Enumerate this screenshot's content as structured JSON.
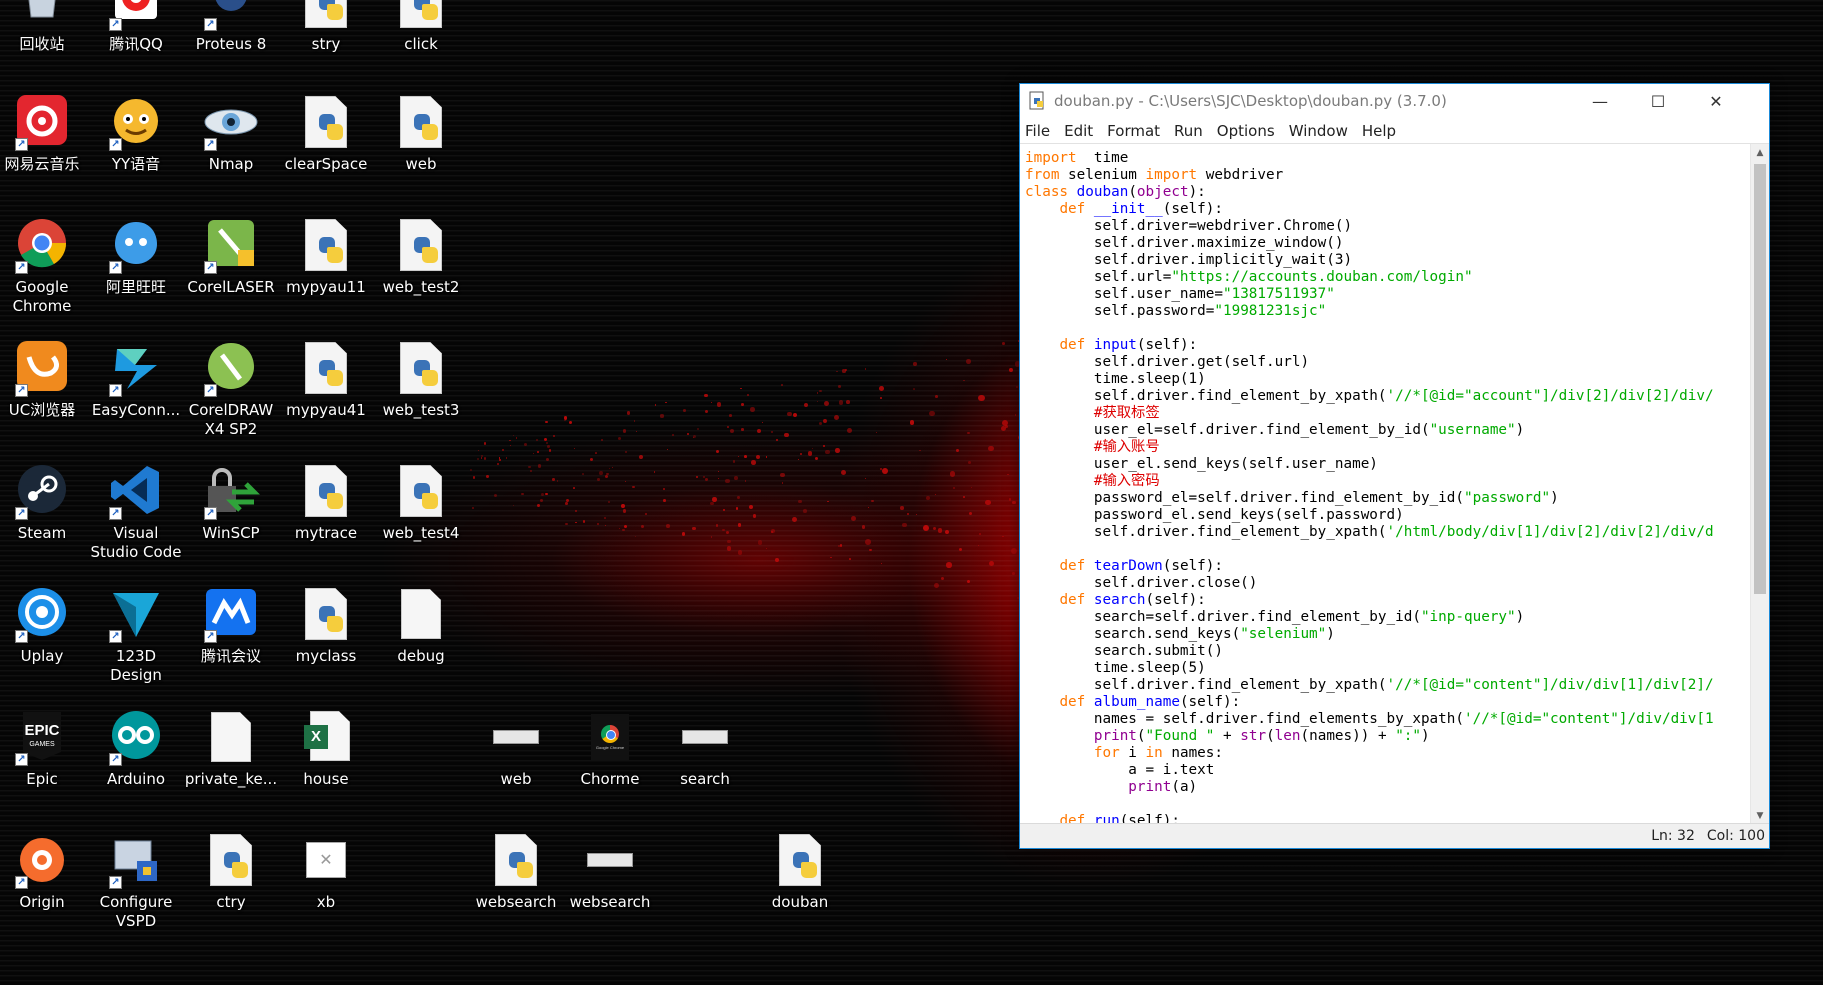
{
  "window": {
    "title": "douban.py - C:\\Users\\SJC\\Desktop\\douban.py (3.7.0)",
    "minimize": "—",
    "maximize": "☐",
    "close": "✕"
  },
  "menu": [
    "File",
    "Edit",
    "Format",
    "Run",
    "Options",
    "Window",
    "Help"
  ],
  "status": {
    "line": "Ln: 32",
    "col": "Col: 100"
  },
  "desktop_icons": [
    {
      "label": "回收站",
      "icon": "recycle-bin-icon"
    },
    {
      "label": "腾讯QQ",
      "icon": "qq-icon"
    },
    {
      "label": "Proteus 8",
      "icon": "proteus-icon"
    },
    {
      "label": "stry",
      "icon": "python-file-icon"
    },
    {
      "label": "click",
      "icon": "python-file-icon"
    },
    {
      "label": "网易云音乐",
      "icon": "netease-music-icon"
    },
    {
      "label": "YY语音",
      "icon": "yy-voice-icon"
    },
    {
      "label": "Nmap",
      "icon": "nmap-icon"
    },
    {
      "label": "clearSpace",
      "icon": "python-file-icon"
    },
    {
      "label": "web",
      "icon": "python-file-icon"
    },
    {
      "label": "Google Chrome",
      "icon": "chrome-icon"
    },
    {
      "label": "阿里旺旺",
      "icon": "aliwangwang-icon"
    },
    {
      "label": "CorelLASER",
      "icon": "corel-laser-icon"
    },
    {
      "label": "mypyau11",
      "icon": "python-file-icon"
    },
    {
      "label": "web_test2",
      "icon": "python-file-icon"
    },
    {
      "label": "UC浏览器",
      "icon": "uc-browser-icon"
    },
    {
      "label": "EasyConn...",
      "icon": "easyconnect-icon"
    },
    {
      "label": "CorelDRAW X4 SP2",
      "icon": "coreldraw-icon"
    },
    {
      "label": "mypyau41",
      "icon": "python-file-icon"
    },
    {
      "label": "web_test3",
      "icon": "python-file-icon"
    },
    {
      "label": "Steam",
      "icon": "steam-icon"
    },
    {
      "label": "Visual Studio Code",
      "icon": "vscode-icon"
    },
    {
      "label": "WinSCP",
      "icon": "winscp-icon"
    },
    {
      "label": "mytrace",
      "icon": "python-file-icon"
    },
    {
      "label": "web_test4",
      "icon": "python-file-icon"
    },
    {
      "label": "Uplay",
      "icon": "uplay-icon"
    },
    {
      "label": "123D Design",
      "icon": "123d-design-icon"
    },
    {
      "label": "腾讯会议",
      "icon": "tencent-meeting-icon"
    },
    {
      "label": "myclass",
      "icon": "python-file-icon"
    },
    {
      "label": "debug",
      "icon": "blank-file-icon"
    },
    {
      "label": "Epic",
      "icon": "epic-games-icon"
    },
    {
      "label": "Arduino",
      "icon": "arduino-icon"
    },
    {
      "label": "private_ke...",
      "icon": "blank-file-icon"
    },
    {
      "label": "house",
      "icon": "excel-file-icon"
    },
    {
      "label": "web",
      "icon": "image-thumbnail-icon"
    },
    {
      "label": "Chorme",
      "icon": "chrome-thumbnail-icon"
    },
    {
      "label": "search",
      "icon": "image-thumbnail-icon"
    },
    {
      "label": "Origin",
      "icon": "origin-icon"
    },
    {
      "label": "Configure VSPD",
      "icon": "vspd-icon"
    },
    {
      "label": "ctry",
      "icon": "python-file-icon"
    },
    {
      "label": "xb",
      "icon": "broken-image-icon"
    },
    {
      "label": "websearch",
      "icon": "python-file-icon"
    },
    {
      "label": "websearch",
      "icon": "image-thumbnail-icon"
    },
    {
      "label": "douban",
      "icon": "python-file-icon"
    }
  ],
  "thumbnail_caption": "Google Chrome",
  "code_lines": [
    [
      [
        "kw",
        "import"
      ],
      [
        "",
        "  time"
      ]
    ],
    [
      [
        "kw",
        "from"
      ],
      [
        "",
        " selenium "
      ],
      [
        "kw",
        "import"
      ],
      [
        "",
        " webdriver"
      ]
    ],
    [
      [
        "kw",
        "class"
      ],
      [
        "",
        " "
      ],
      [
        "fn",
        "douban"
      ],
      [
        "",
        "("
      ],
      [
        "bi",
        "object"
      ],
      [
        "",
        "):"
      ]
    ],
    [
      [
        "",
        "    "
      ],
      [
        "kw",
        "def"
      ],
      [
        "",
        " "
      ],
      [
        "fn",
        "__init__"
      ],
      [
        "",
        "(self):"
      ]
    ],
    [
      [
        "",
        "        self.driver=webdriver.Chrome()"
      ]
    ],
    [
      [
        "",
        "        self.driver.maximize_window()"
      ]
    ],
    [
      [
        "",
        "        self.driver.implicitly_wait(3)"
      ]
    ],
    [
      [
        "",
        "        self.url="
      ],
      [
        "st",
        "\"https://accounts.douban.com/login\""
      ]
    ],
    [
      [
        "",
        "        self.user_name="
      ],
      [
        "st",
        "\"13817511937\""
      ]
    ],
    [
      [
        "",
        "        self.password="
      ],
      [
        "st",
        "\"19981231sjc\""
      ]
    ],
    [
      [
        "",
        ""
      ]
    ],
    [
      [
        "",
        "    "
      ],
      [
        "kw",
        "def"
      ],
      [
        "",
        " "
      ],
      [
        "fn",
        "input"
      ],
      [
        "",
        "(self):"
      ]
    ],
    [
      [
        "",
        "        self.driver.get(self.url)"
      ]
    ],
    [
      [
        "",
        "        time.sleep(1)"
      ]
    ],
    [
      [
        "",
        "        self.driver.find_element_by_xpath("
      ],
      [
        "st",
        "'//*[@id=\"account\"]/div[2]/div[2]/div/"
      ]
    ],
    [
      [
        "cm",
        "        #获取标签"
      ]
    ],
    [
      [
        "",
        "        user_el=self.driver.find_element_by_id("
      ],
      [
        "st",
        "\"username\""
      ],
      [
        "",
        ")"
      ]
    ],
    [
      [
        "cm",
        "        #输入账号"
      ]
    ],
    [
      [
        "",
        "        user_el.send_keys(self.user_name)"
      ]
    ],
    [
      [
        "cm",
        "        #输入密码"
      ]
    ],
    [
      [
        "",
        "        password_el=self.driver.find_element_by_id("
      ],
      [
        "st",
        "\"password\""
      ],
      [
        "",
        ")"
      ]
    ],
    [
      [
        "",
        "        password_el.send_keys(self.password)"
      ]
    ],
    [
      [
        "",
        "        self.driver.find_element_by_xpath("
      ],
      [
        "st",
        "'/html/body/div[1]/div[2]/div[2]/div/d"
      ]
    ],
    [
      [
        "",
        ""
      ]
    ],
    [
      [
        "",
        "    "
      ],
      [
        "kw",
        "def"
      ],
      [
        "",
        " "
      ],
      [
        "fn",
        "tearDown"
      ],
      [
        "",
        "(self):"
      ]
    ],
    [
      [
        "",
        "        self.driver.close()"
      ]
    ],
    [
      [
        "",
        "    "
      ],
      [
        "kw",
        "def"
      ],
      [
        "",
        " "
      ],
      [
        "fn",
        "search"
      ],
      [
        "",
        "(self):"
      ]
    ],
    [
      [
        "",
        "        search=self.driver.find_element_by_id("
      ],
      [
        "st",
        "\"inp-query\""
      ],
      [
        "",
        ")"
      ]
    ],
    [
      [
        "",
        "        search.send_keys("
      ],
      [
        "st",
        "\"selenium\""
      ],
      [
        "",
        ")"
      ]
    ],
    [
      [
        "",
        "        search.submit()"
      ]
    ],
    [
      [
        "",
        "        time.sleep(5)"
      ]
    ],
    [
      [
        "",
        "        self.driver.find_element_by_xpath("
      ],
      [
        "st",
        "'//*[@id=\"content\"]/div/div[1]/div[2]/"
      ]
    ],
    [
      [
        "",
        "    "
      ],
      [
        "kw",
        "def"
      ],
      [
        "",
        " "
      ],
      [
        "fn",
        "album_name"
      ],
      [
        "",
        "(self):"
      ]
    ],
    [
      [
        "",
        "        names = self.driver.find_elements_by_xpath("
      ],
      [
        "st",
        "'//*[@id=\"content\"]/div/div[1"
      ]
    ],
    [
      [
        "",
        "        "
      ],
      [
        "bi",
        "print"
      ],
      [
        "",
        "("
      ],
      [
        "st",
        "\"Found \""
      ],
      [
        "",
        " + "
      ],
      [
        "bi",
        "str"
      ],
      [
        "",
        "("
      ],
      [
        "bi",
        "len"
      ],
      [
        "",
        "(names)) + "
      ],
      [
        "st",
        "\":\""
      ],
      [
        "",
        ")"
      ]
    ],
    [
      [
        "",
        "        "
      ],
      [
        "kw",
        "for"
      ],
      [
        "",
        " i "
      ],
      [
        "kw",
        "in"
      ],
      [
        "",
        " names:"
      ]
    ],
    [
      [
        "",
        "            a = i.text"
      ]
    ],
    [
      [
        "",
        "            "
      ],
      [
        "bi",
        "print"
      ],
      [
        "",
        "(a)"
      ]
    ],
    [
      [
        "",
        ""
      ]
    ],
    [
      [
        "",
        "    "
      ],
      [
        "kw",
        "def"
      ],
      [
        "",
        " "
      ],
      [
        "fn",
        "run"
      ],
      [
        "",
        "(self):"
      ]
    ]
  ]
}
